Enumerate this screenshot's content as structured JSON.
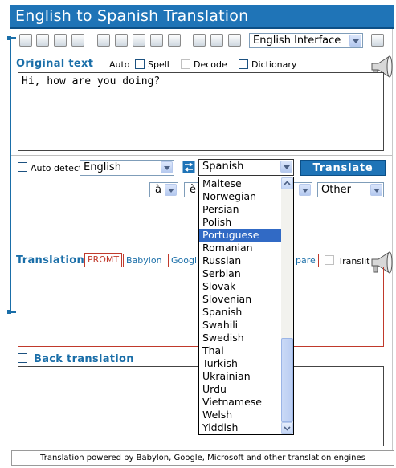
{
  "title": "English to Spanish Translation",
  "toolbar": {
    "icons": [
      "new-document-icon",
      "print-icon",
      "cut-icon",
      "delete-icon",
      "dictionary-icon",
      "spell-check-icon",
      "keyboard-icon",
      "options-icon",
      "virtual-keyboard-icon",
      "print-result-icon",
      "image-icon",
      "help-icon"
    ],
    "interface_select": "English Interface"
  },
  "original": {
    "label": "Original text",
    "auto_label": "Auto",
    "spell_label": "Spell",
    "decode_label": "Decode",
    "dictionary_label": "Dictionary",
    "text": "Hi, how are you doing?"
  },
  "language": {
    "auto_detect_label": "Auto detect",
    "source": "English",
    "target": "Spanish",
    "translate_label": "Translate",
    "char1": "à",
    "char2": "è",
    "other": "Other"
  },
  "translation": {
    "label": "Translation",
    "tabs": [
      "PROMT",
      "Babylon",
      "Googl",
      "pare"
    ],
    "translit_label": "Translit"
  },
  "back_translation": {
    "label": "Back translation"
  },
  "footer": "Translation powered by Babylon, Google, Microsoft and other translation engines",
  "dropdown": {
    "items": [
      "Maltese",
      "Norwegian",
      "Persian",
      "Polish",
      "Portuguese",
      "Romanian",
      "Russian",
      "Serbian",
      "Slovak",
      "Slovenian",
      "Spanish",
      "Swahili",
      "Swedish",
      "Thai",
      "Turkish",
      "Ukrainian",
      "Urdu",
      "Vietnamese",
      "Welsh",
      "Yiddish"
    ],
    "highlighted": "Portuguese"
  },
  "colors": {
    "accent": "#1f74b7",
    "tab_border": "#c0392b",
    "selection": "#316ac5"
  }
}
